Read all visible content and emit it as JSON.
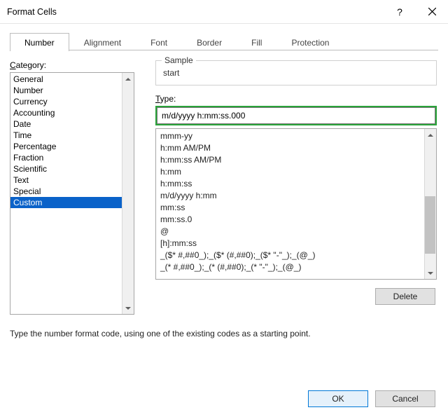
{
  "title": "Format Cells",
  "tabs": [
    "Number",
    "Alignment",
    "Font",
    "Border",
    "Fill",
    "Protection"
  ],
  "activeTab": 0,
  "category": {
    "label_pre": "C",
    "label_post": "ategory:",
    "items": [
      "General",
      "Number",
      "Currency",
      "Accounting",
      "Date",
      "Time",
      "Percentage",
      "Fraction",
      "Scientific",
      "Text",
      "Special",
      "Custom"
    ],
    "selectedIndex": 11
  },
  "sample": {
    "legend": "Sample",
    "value": "start"
  },
  "type": {
    "label_pre": "T",
    "label_post": "ype:",
    "value": "m/d/yyyy h:mm:ss.000"
  },
  "presets": [
    "mmm-yy",
    "h:mm AM/PM",
    "h:mm:ss AM/PM",
    "h:mm",
    "h:mm:ss",
    "m/d/yyyy h:mm",
    "mm:ss",
    "mm:ss.0",
    "@",
    "[h]:mm:ss",
    "_($* #,##0_);_($* (#,##0);_($* \"-\"_);_(@_)",
    "_(* #,##0_);_(* (#,##0);_(* \"-\"_);_(@_)"
  ],
  "buttons": {
    "delete": "Delete",
    "ok": "OK",
    "cancel": "Cancel"
  },
  "helpText": "Type the number format code, using one of the existing codes as a starting point."
}
